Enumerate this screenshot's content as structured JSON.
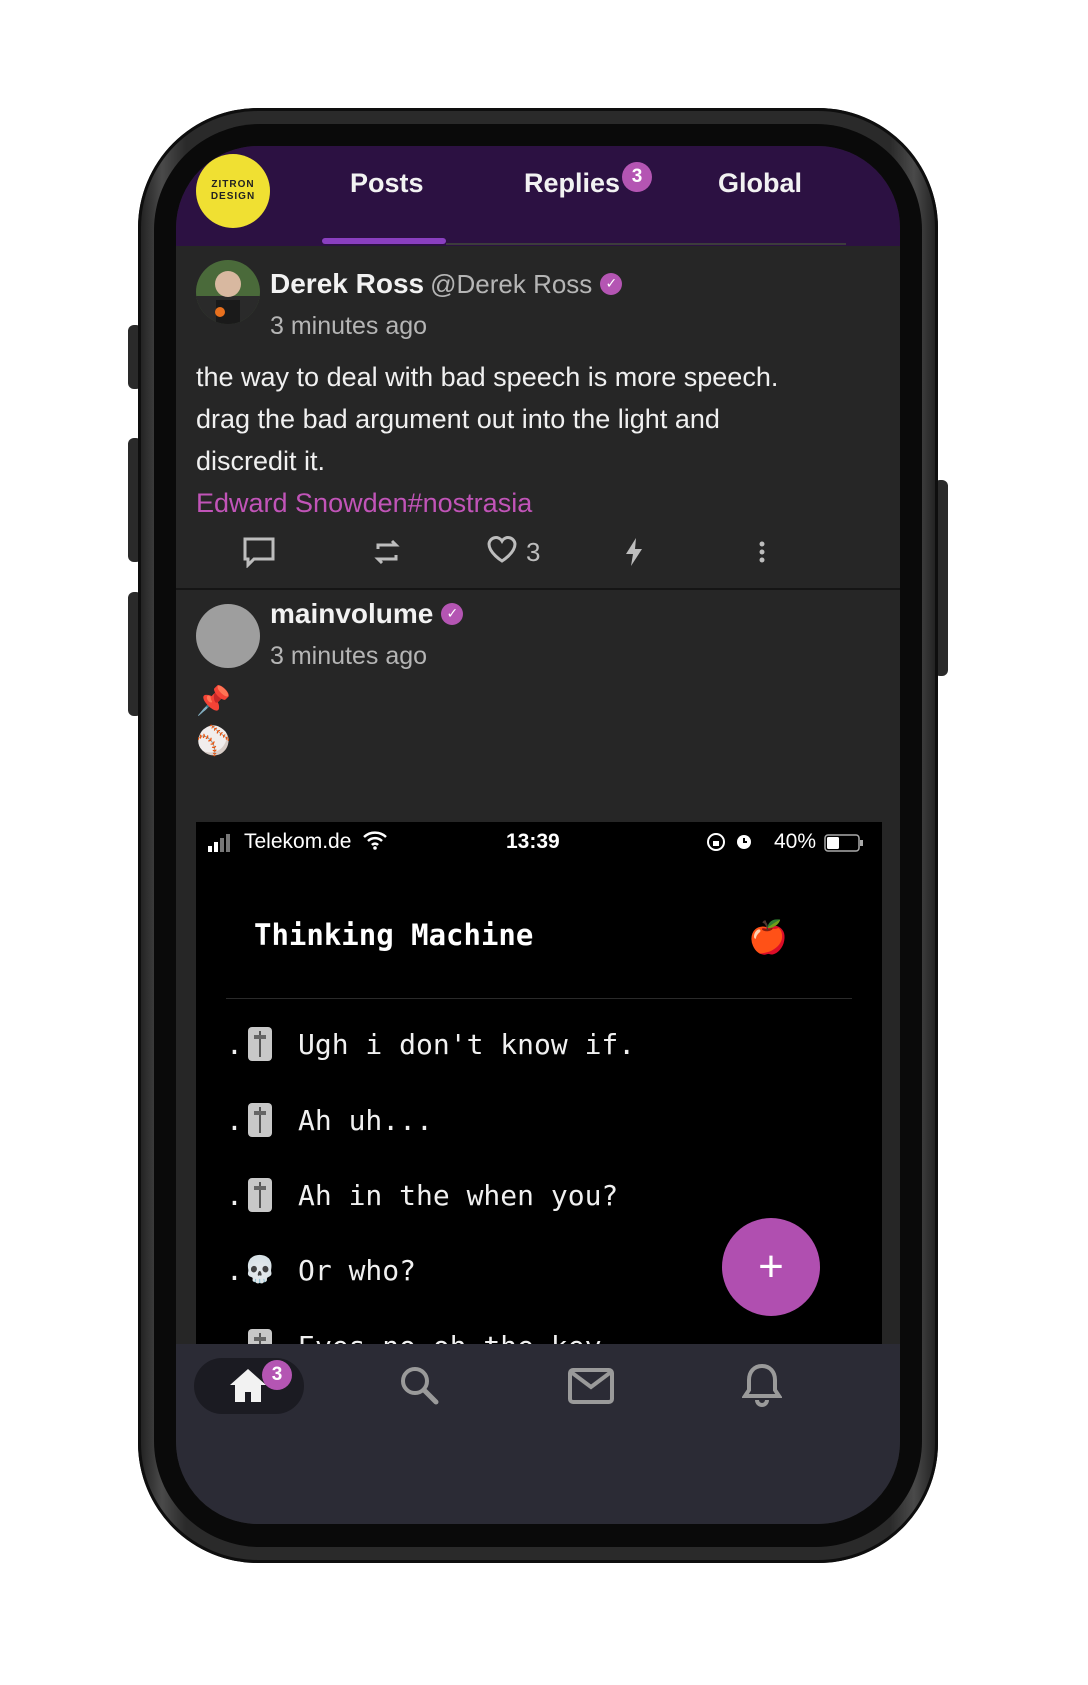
{
  "brand": {
    "logo_text": "ZITRON DESIGN",
    "accent": "#b455b3",
    "header_bg": "#2c1142"
  },
  "tabs": [
    {
      "label": "Posts",
      "active": true
    },
    {
      "label": "Replies",
      "badge": "3"
    },
    {
      "label": "Global"
    }
  ],
  "posts": [
    {
      "author": "Derek Ross",
      "handle": "@Derek Ross",
      "verified": true,
      "time": "3 minutes ago",
      "text_lines": [
        "the way to deal with bad speech is more speech.",
        "drag the bad argument out into the light and",
        "discredit it."
      ],
      "link_text": "Edward Snowden#nostrasia",
      "like_count": "3",
      "actions": [
        "comment-icon",
        "repost-icon",
        "heart-icon",
        "zap-icon",
        "more-icon"
      ]
    },
    {
      "author": "mainvolume",
      "verified": true,
      "time": "3 minutes ago",
      "emoji_1": "📌",
      "emoji_2": "⚾",
      "embed": {
        "carrier": "Telekom.de",
        "time": "13:39",
        "battery": "40%",
        "title": "Thinking Machine",
        "title_emoji": "🍎",
        "lines": [
          {
            "prefix": ".",
            "icon": "dial",
            "text": "Ugh i don't know if."
          },
          {
            "prefix": ".",
            "icon": "dial",
            "text": "Ah uh..."
          },
          {
            "prefix": ".",
            "icon": "dial",
            "text": "Ah in the when you?"
          },
          {
            "prefix": ".",
            "icon": "skull",
            "emoji": "💀",
            "text": "Or who?"
          },
          {
            "prefix": ".",
            "icon": "dial",
            "text": "Eyes no oh the key."
          }
        ]
      }
    }
  ],
  "fab": {
    "label": "+"
  },
  "bottom_nav": {
    "items": [
      "home-icon",
      "search-icon",
      "mail-icon",
      "bell-icon"
    ],
    "home_badge": "3"
  }
}
